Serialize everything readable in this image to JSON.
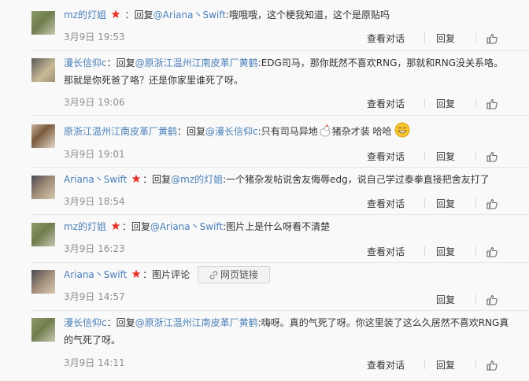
{
  "labels": {
    "reply_prefix": "：回复",
    "at": "@",
    "view_conversation": "查看对话",
    "reply": "回复",
    "weblink": "网页链接",
    "sep": ":",
    "colon_full": "："
  },
  "comments": [
    {
      "author": "mz的灯姐",
      "vip": true,
      "target": "Ariana丶Swift",
      "content": "哦哦哦，这个梗我知道，这个是原贴吗",
      "time": "3月9日 19:53",
      "has_view": true
    },
    {
      "author": "漫长信仰c",
      "vip": false,
      "target": "原浙江温州江南皮革厂黄鹤",
      "content": "EDG司马，那你既然不喜欢RNG，那就和RNG没关系咯。那就是你死爸了咯？还是你家里谁死了呀。",
      "time": "3月9日 19:06",
      "has_view": true
    },
    {
      "author": "原浙江温州江南皮革厂黄鹤",
      "vip": false,
      "target": "漫长信仰c",
      "content_a": "只有司马异地",
      "content_b": "猪杂才装 哈哈",
      "time": "3月9日 19:01",
      "has_view": true
    },
    {
      "author": "Ariana丶Swift",
      "vip": true,
      "target": "mz的灯姐",
      "content": "一个猪杂发帖说舍友侮辱edg，说自己学过泰拳直接把舍友打了",
      "time": "3月9日 18:54",
      "has_view": true
    },
    {
      "author": "mz的灯姐",
      "vip": true,
      "target": "Ariana丶Swift",
      "content": "图片上是什么呀看不清楚",
      "time": "3月9日 16:23",
      "has_view": true
    },
    {
      "author": "Ariana丶Swift",
      "vip": true,
      "content": "：图片评论",
      "time": "3月9日 14:57",
      "has_view": false
    },
    {
      "author": "漫长信仰c",
      "vip": false,
      "target": "原浙江温州江南皮革厂黄鹤",
      "content": "嗨呀。真的气死了呀。你这里装了这么久居然不喜欢RNG真的气死了呀。",
      "time": "3月9日 14:11",
      "has_view": true
    }
  ],
  "colors": {
    "link": "#4a7fb8",
    "vip_star": "#e8352b",
    "text": "#333333",
    "time": "#8f8f8f"
  },
  "icons": {
    "vip": "red-star-icon",
    "like": "thumbs-up-icon",
    "link": "link-icon",
    "rooster": "rooster-emoji",
    "grin": "grin-emoji"
  }
}
